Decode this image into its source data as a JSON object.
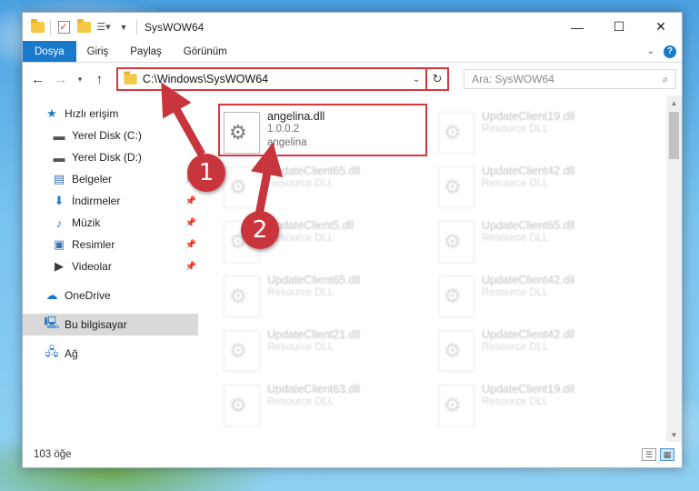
{
  "window": {
    "title": "SysWOW64"
  },
  "title_controls": {
    "minimize": "—",
    "maximize": "☐",
    "close": "✕"
  },
  "ribbon": {
    "tabs": [
      "Dosya",
      "Giriş",
      "Paylaş",
      "Görünüm"
    ],
    "help": "?"
  },
  "address": {
    "path": "C:\\Windows\\SysWOW64",
    "search_placeholder": "Ara: SysWOW64"
  },
  "navigation": {
    "quick_access": "Hızlı erişim",
    "items": [
      {
        "label": "Yerel Disk (C:)",
        "icon": "drive-icon"
      },
      {
        "label": "Yerel Disk (D:)",
        "icon": "drive-icon"
      },
      {
        "label": "Belgeler",
        "icon": "documents-icon",
        "pinned": true
      },
      {
        "label": "İndirmeler",
        "icon": "downloads-icon",
        "pinned": true
      },
      {
        "label": "Müzik",
        "icon": "music-icon",
        "pinned": true
      },
      {
        "label": "Resimler",
        "icon": "pictures-icon",
        "pinned": true
      },
      {
        "label": "Videolar",
        "icon": "videos-icon",
        "pinned": true
      }
    ],
    "onedrive": "OneDrive",
    "this_pc": "Bu bilgisayar",
    "network": "Ağ"
  },
  "files": {
    "primary": {
      "name": "angelina.dll",
      "version": "1.0.0.2",
      "company": "angelina"
    },
    "left_column": [
      {
        "name": "UpdateClient65.dll",
        "type": "Resource DLL"
      },
      {
        "name": "UpdateClient5.dll",
        "type": "Resource DLL"
      },
      {
        "name": "UpdateClient65.dll",
        "type": "Resource DLL"
      },
      {
        "name": "UpdateClient21.dll",
        "type": "Resource DLL"
      },
      {
        "name": "UpdateClient63.dll",
        "type": "Resource DLL"
      }
    ],
    "right_column": [
      {
        "name": "UpdateClient19.dll",
        "type": "Resource DLL"
      },
      {
        "name": "UpdateClient42.dll",
        "type": "Resource DLL"
      },
      {
        "name": "UpdateClient65.dll",
        "type": "Resource DLL"
      },
      {
        "name": "UpdateClient42.dll",
        "type": "Resource DLL"
      },
      {
        "name": "UpdateClient42.dll",
        "type": "Resource DLL"
      },
      {
        "name": "UpdateClient19.dll",
        "type": "Resource DLL"
      }
    ]
  },
  "status": {
    "count": "103 öğe"
  },
  "annotations": {
    "step1": "1",
    "step2": "2"
  },
  "colors": {
    "accent": "#1979ca",
    "highlight": "#d9363e",
    "badge": "#c9353d"
  }
}
